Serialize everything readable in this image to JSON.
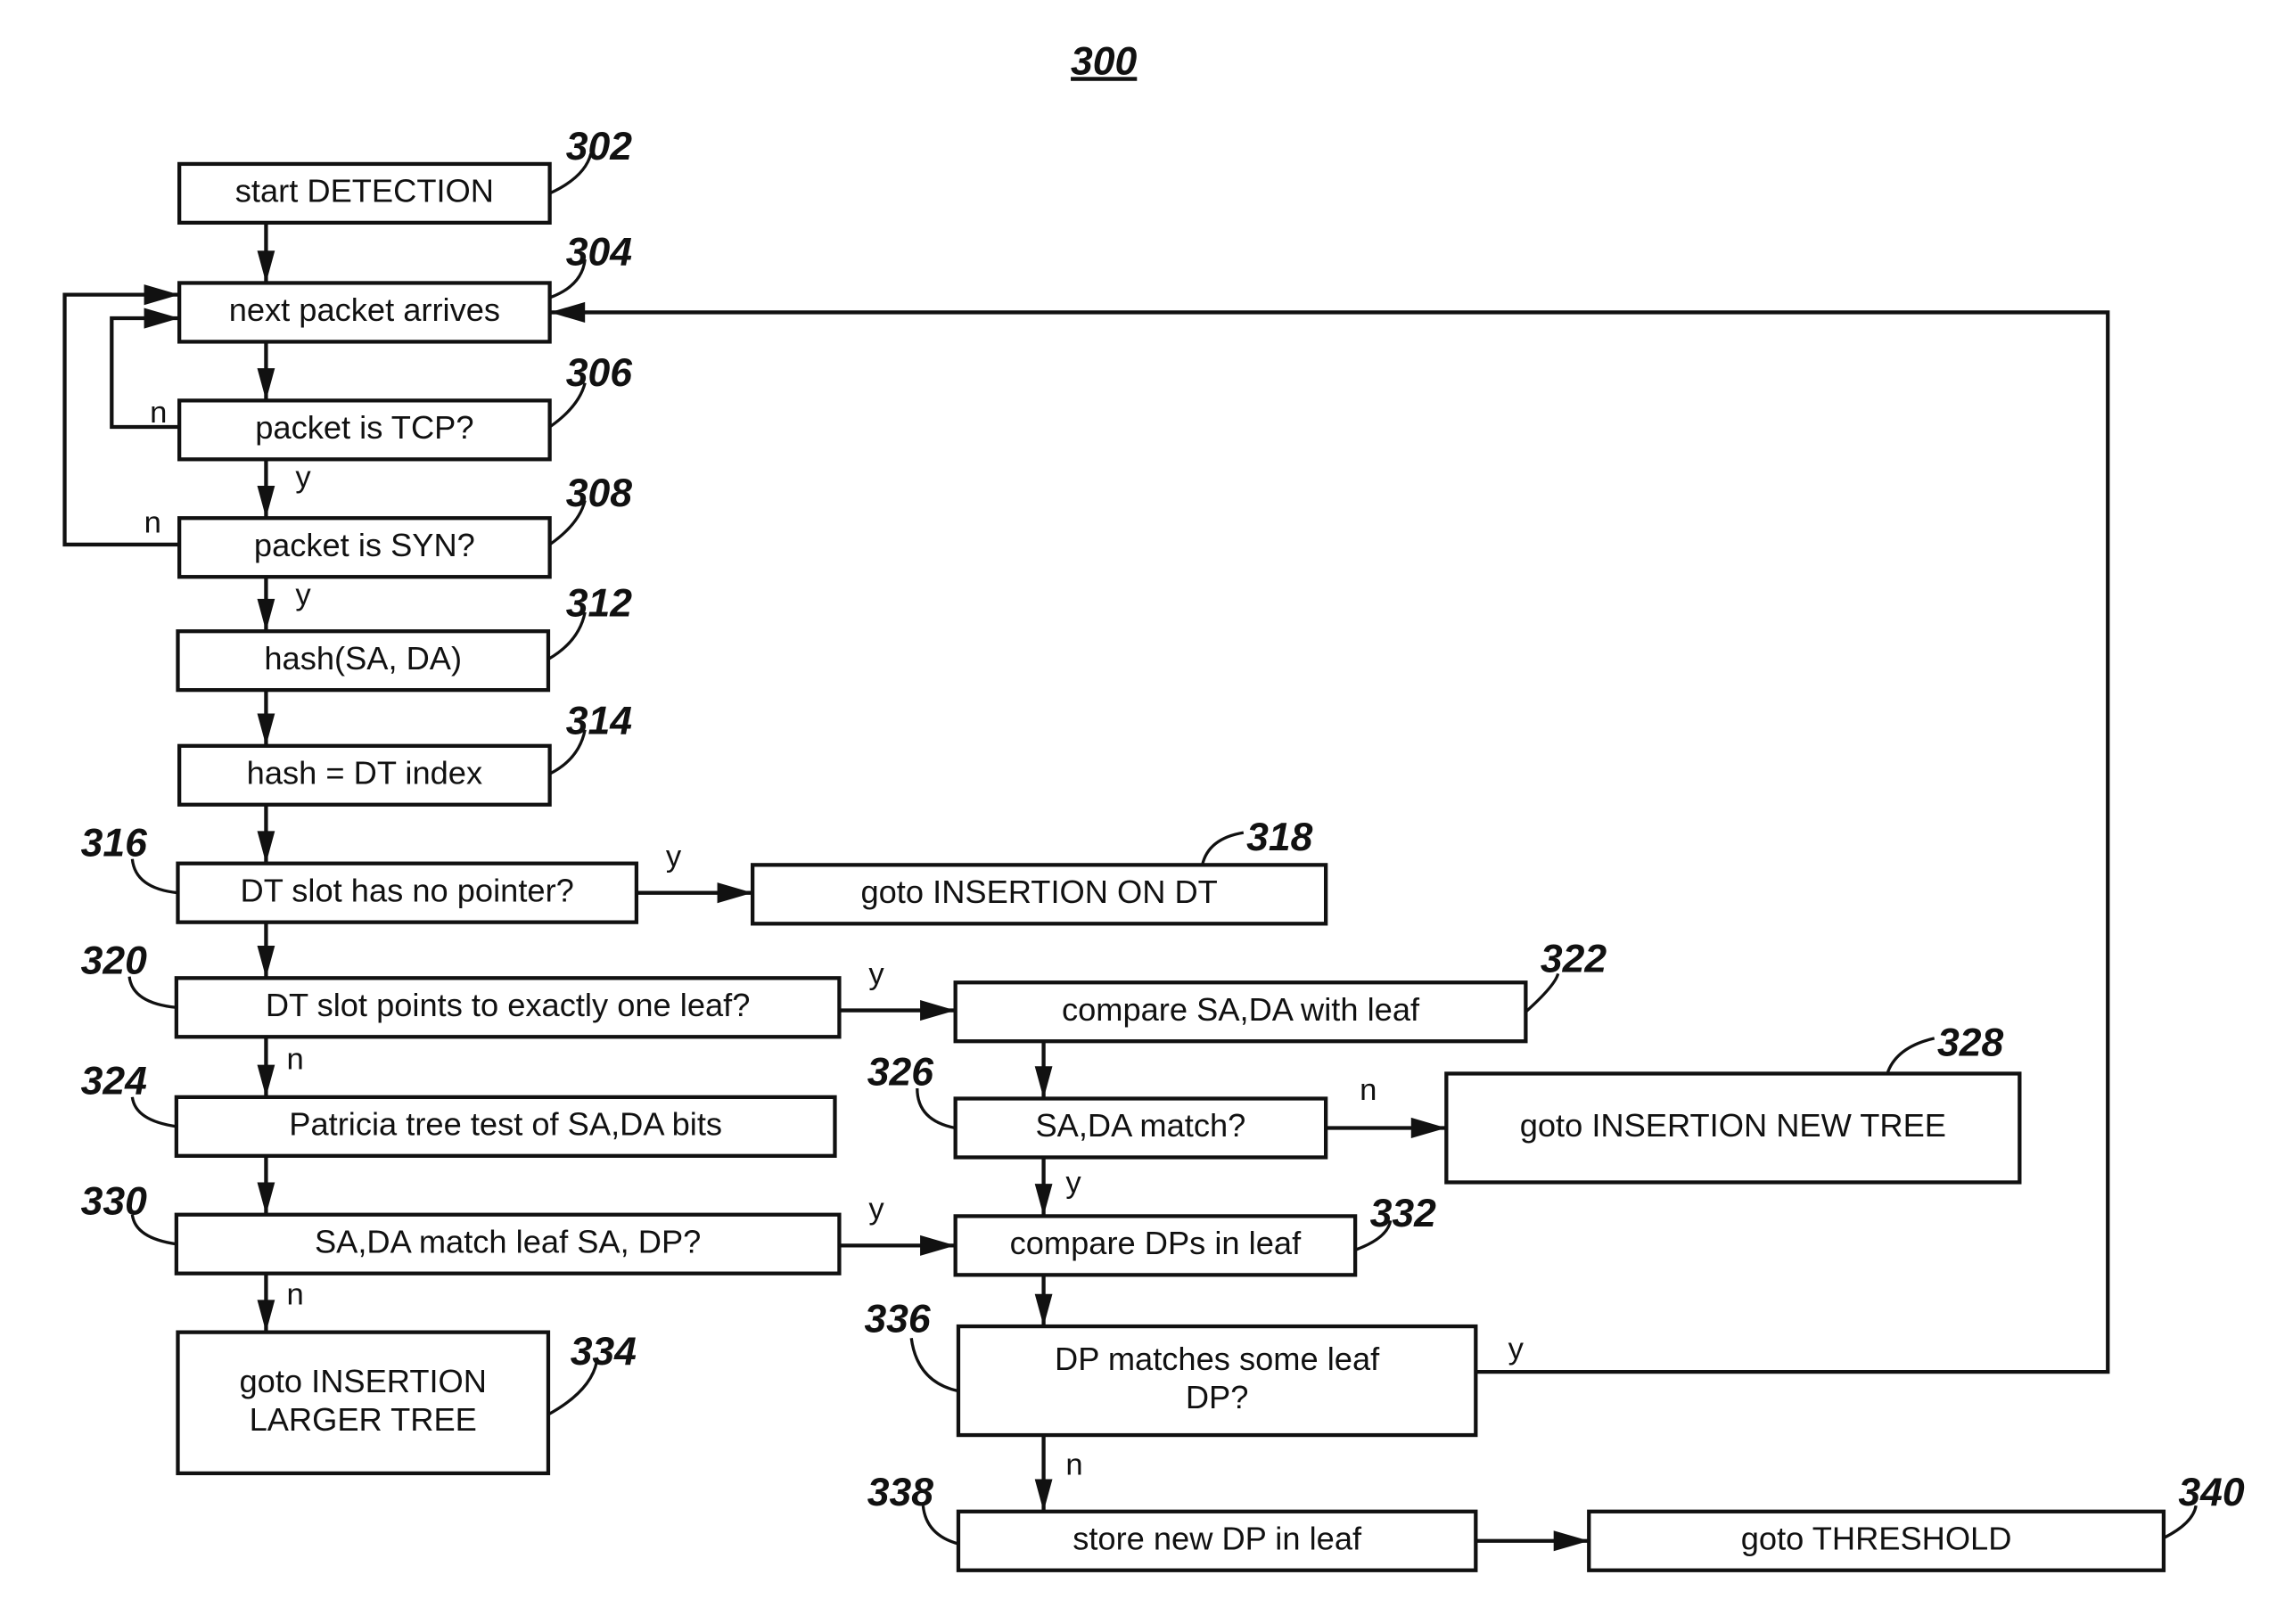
{
  "figure": {
    "number": "300",
    "accent_color": "#111111",
    "background_color": "#ffffff"
  },
  "steps": {
    "s302": {
      "ref": "302",
      "lines": [
        "start DETECTION"
      ]
    },
    "s304": {
      "ref": "304",
      "lines": [
        "next packet arrives"
      ]
    },
    "s306": {
      "ref": "306",
      "lines": [
        "packet is TCP?"
      ]
    },
    "s308": {
      "ref": "308",
      "lines": [
        "packet is SYN?"
      ]
    },
    "s312": {
      "ref": "312",
      "lines": [
        "hash(SA, DA)"
      ]
    },
    "s314": {
      "ref": "314",
      "lines": [
        "hash = DT index"
      ]
    },
    "s316": {
      "ref": "316",
      "lines": [
        "DT slot has no pointer?"
      ]
    },
    "s318": {
      "ref": "318",
      "lines": [
        "goto INSERTION ON DT"
      ]
    },
    "s320": {
      "ref": "320",
      "lines": [
        "DT slot points to exactly one leaf?"
      ]
    },
    "s322": {
      "ref": "322",
      "lines": [
        "compare SA,DA with leaf"
      ]
    },
    "s324": {
      "ref": "324",
      "lines": [
        "Patricia tree test of SA,DA bits"
      ]
    },
    "s326": {
      "ref": "326",
      "lines": [
        "SA,DA match?"
      ]
    },
    "s328": {
      "ref": "328",
      "lines": [
        "goto INSERTION NEW TREE"
      ]
    },
    "s330": {
      "ref": "330",
      "lines": [
        "SA,DA match leaf SA, DP?"
      ]
    },
    "s332": {
      "ref": "332",
      "lines": [
        "compare DPs in leaf"
      ]
    },
    "s334": {
      "ref": "334",
      "lines": [
        "goto INSERTION",
        "LARGER TREE"
      ]
    },
    "s336": {
      "ref": "336",
      "lines": [
        "DP matches some leaf",
        "DP?"
      ]
    },
    "s338": {
      "ref": "338",
      "lines": [
        "store new DP in leaf"
      ]
    },
    "s340": {
      "ref": "340",
      "lines": [
        "goto THRESHOLD"
      ]
    }
  },
  "branch_labels": {
    "yes": "y",
    "no": "n"
  },
  "edges": [
    {
      "from": "302",
      "to": "304",
      "label": ""
    },
    {
      "from": "304",
      "to": "306",
      "label": ""
    },
    {
      "from": "306",
      "to": "304",
      "label": "n"
    },
    {
      "from": "306",
      "to": "308",
      "label": "y"
    },
    {
      "from": "308",
      "to": "304",
      "label": "n"
    },
    {
      "from": "308",
      "to": "312",
      "label": "y"
    },
    {
      "from": "312",
      "to": "314",
      "label": ""
    },
    {
      "from": "314",
      "to": "316",
      "label": ""
    },
    {
      "from": "316",
      "to": "318",
      "label": "y"
    },
    {
      "from": "316",
      "to": "320",
      "label": ""
    },
    {
      "from": "320",
      "to": "322",
      "label": "y"
    },
    {
      "from": "320",
      "to": "324",
      "label": "n"
    },
    {
      "from": "322",
      "to": "326",
      "label": ""
    },
    {
      "from": "326",
      "to": "328",
      "label": "n"
    },
    {
      "from": "326",
      "to": "332",
      "label": "y"
    },
    {
      "from": "324",
      "to": "330",
      "label": ""
    },
    {
      "from": "330",
      "to": "332",
      "label": "y"
    },
    {
      "from": "330",
      "to": "334",
      "label": "n"
    },
    {
      "from": "332",
      "to": "336",
      "label": ""
    },
    {
      "from": "336",
      "to": "304",
      "label": "y"
    },
    {
      "from": "336",
      "to": "338",
      "label": "n"
    },
    {
      "from": "338",
      "to": "340",
      "label": ""
    }
  ]
}
